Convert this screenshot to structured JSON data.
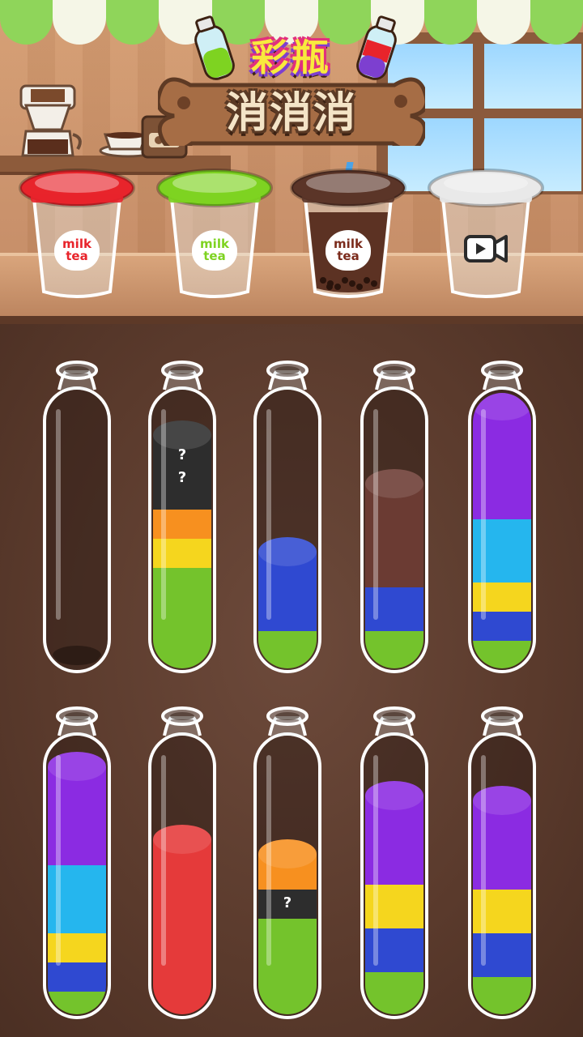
{
  "title": {
    "line1": "彩瓶",
    "line2": "消消消"
  },
  "cups": [
    {
      "label_line1": "milk",
      "label_line2": "tea",
      "lid_color": "#e8242b",
      "fill_color": "",
      "locked": false
    },
    {
      "label_line1": "milk",
      "label_line2": "tea",
      "lid_color": "#7ed321",
      "fill_color": "",
      "locked": false
    },
    {
      "label_line1": "milk",
      "label_line2": "tea",
      "lid_color": "#5b3528",
      "fill_color": "#5c3223",
      "locked": false
    },
    {
      "label_line1": "",
      "label_line2": "",
      "lid_color": "#e9e9e9",
      "fill_color": "",
      "locked": true,
      "icon": "video-play-icon"
    }
  ],
  "tubes": [
    {
      "layers": []
    },
    {
      "layers": [
        {
          "color": "#74c32c",
          "units": 2.1
        },
        {
          "color": "#f5d61e",
          "units": 0.6
        },
        {
          "color": "#f7901f",
          "units": 0.6
        },
        {
          "color": "#2d2d2d",
          "units": 1.5,
          "hidden": true,
          "marks": 2
        }
      ]
    },
    {
      "layers": [
        {
          "color": "#74c32c",
          "units": 0.8
        },
        {
          "color": "#2f49d1",
          "units": 1.6
        }
      ]
    },
    {
      "layers": [
        {
          "color": "#74c32c",
          "units": 0.8
        },
        {
          "color": "#2f49d1",
          "units": 0.9
        },
        {
          "color": "#6b3b33",
          "units": 2.1
        }
      ]
    },
    {
      "layers": [
        {
          "color": "#74c32c",
          "units": 0.6
        },
        {
          "color": "#2f49d1",
          "units": 0.6
        },
        {
          "color": "#f5d61e",
          "units": 0.6
        },
        {
          "color": "#25b6ee",
          "units": 1.3
        },
        {
          "color": "#8b2be2",
          "units": 2.3
        }
      ]
    },
    {
      "layers": [
        {
          "color": "#74c32c",
          "units": 0.5
        },
        {
          "color": "#2f49d1",
          "units": 0.6
        },
        {
          "color": "#f5d61e",
          "units": 0.6
        },
        {
          "color": "#25b6ee",
          "units": 1.4
        },
        {
          "color": "#8b2be2",
          "units": 2.0
        }
      ]
    },
    {
      "layers": [
        {
          "color": "#e53a3a",
          "units": 3.6
        }
      ]
    },
    {
      "layers": [
        {
          "color": "#74c32c",
          "units": 2.0
        },
        {
          "color": "#2d2d2d",
          "units": 0.6,
          "hidden": true,
          "marks": 1
        },
        {
          "color": "#f7901f",
          "units": 0.7
        }
      ]
    },
    {
      "layers": [
        {
          "color": "#74c32c",
          "units": 0.9
        },
        {
          "color": "#2f49d1",
          "units": 0.9
        },
        {
          "color": "#f5d61e",
          "units": 0.9
        },
        {
          "color": "#8b2be2",
          "units": 1.8
        }
      ]
    },
    {
      "layers": [
        {
          "color": "#74c32c",
          "units": 0.8
        },
        {
          "color": "#2f49d1",
          "units": 0.9
        },
        {
          "color": "#f5d61e",
          "units": 0.9
        },
        {
          "color": "#8b2be2",
          "units": 1.8
        }
      ]
    }
  ],
  "hidden_mark": "?"
}
